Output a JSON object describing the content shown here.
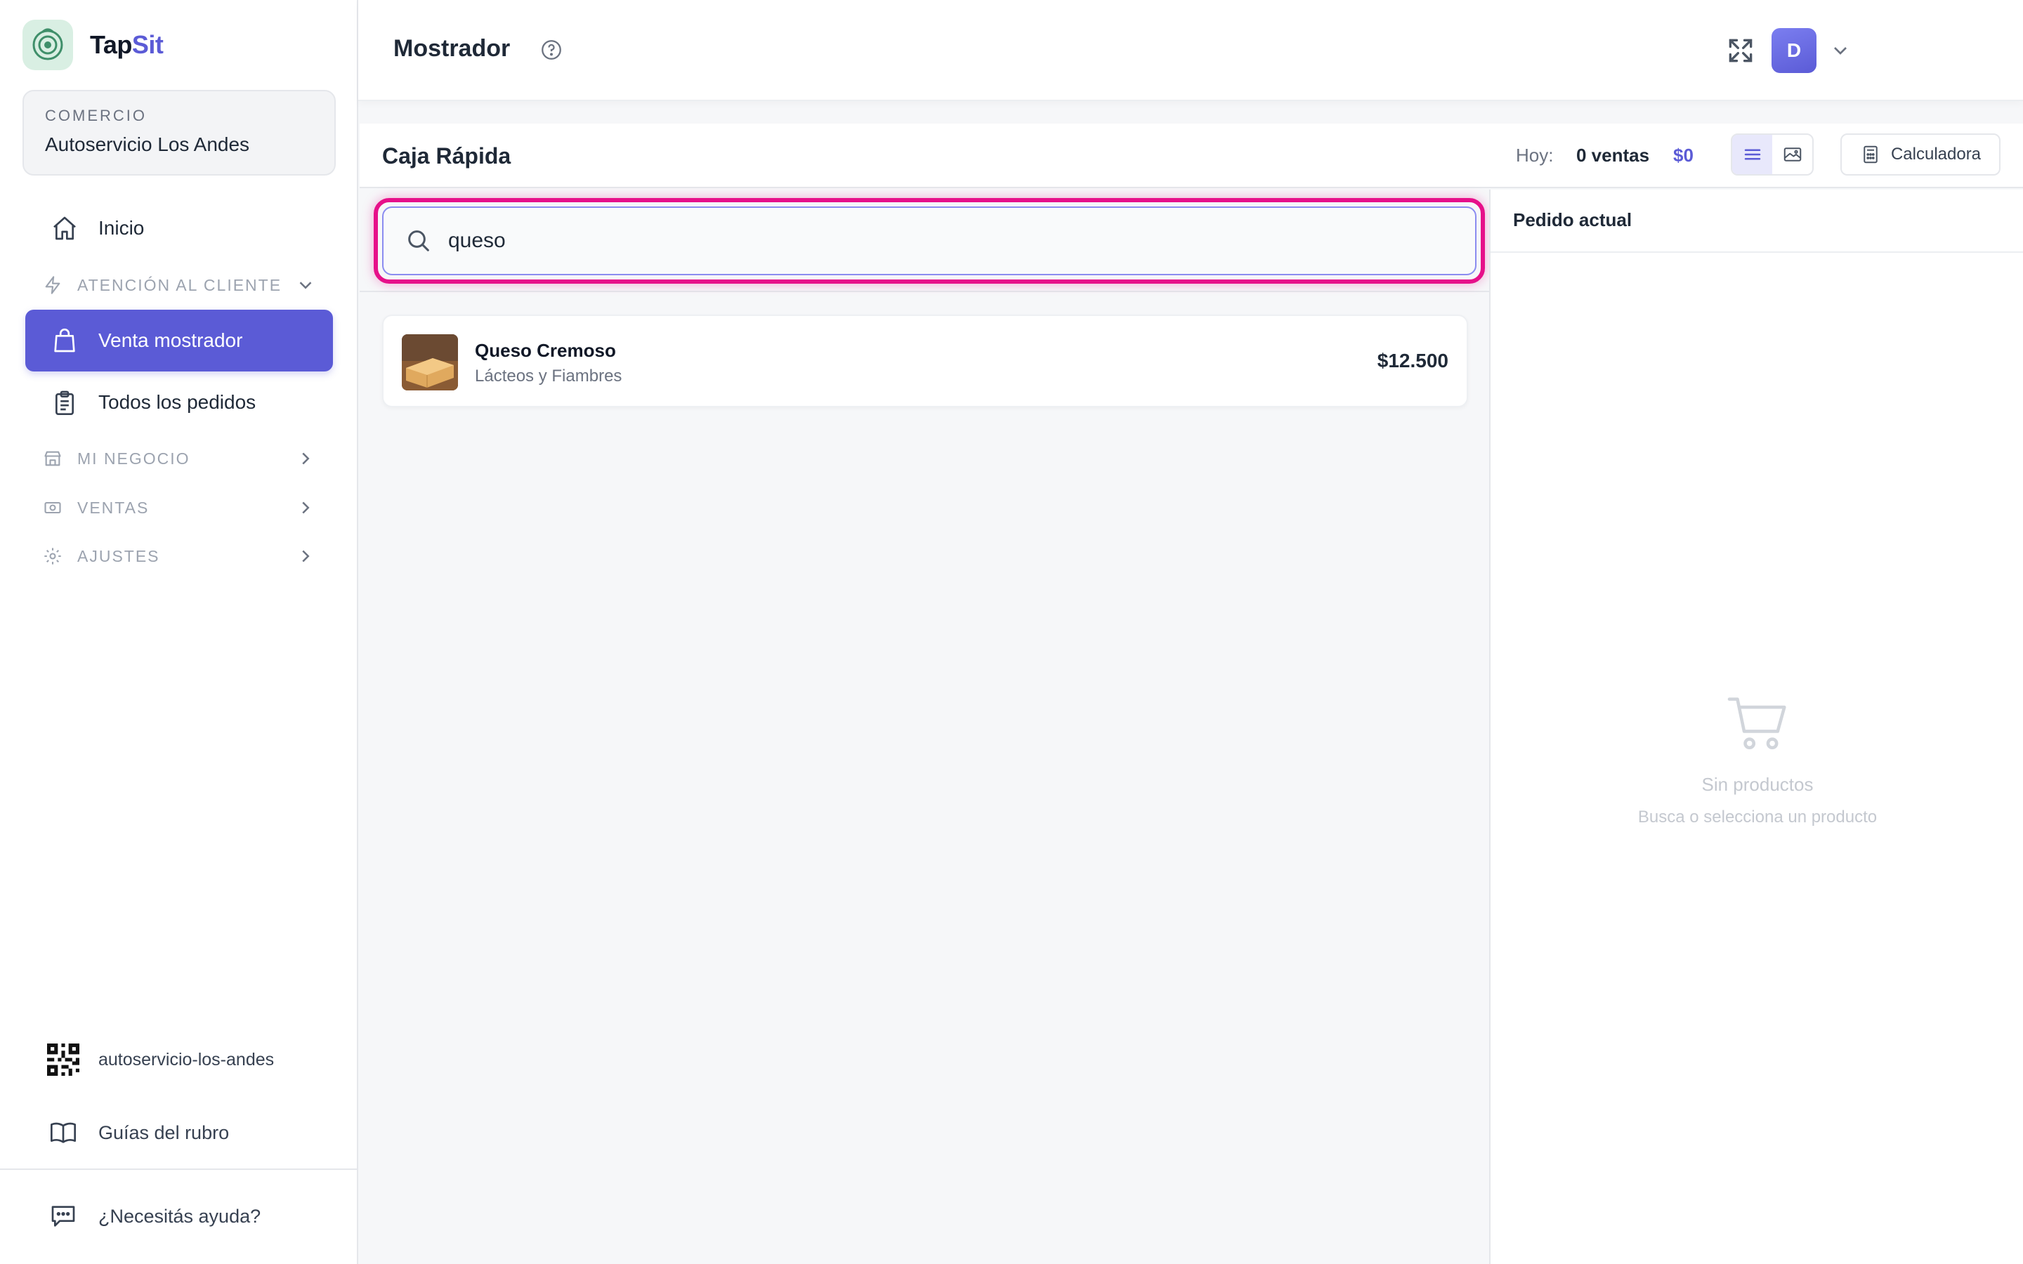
{
  "brand": {
    "name_part1": "Tap",
    "name_part2": "Sit"
  },
  "commerce": {
    "label": "COMERCIO",
    "name": "Autoservicio Los Andes"
  },
  "sidebar": {
    "inicio": "Inicio",
    "section_atencion": "ATENCIÓN AL CLIENTE",
    "venta_mostrador": "Venta mostrador",
    "todos_pedidos": "Todos los pedidos",
    "section_negocio": "MI NEGOCIO",
    "section_ventas": "VENTAS",
    "section_ajustes": "AJUSTES",
    "qr_slug": "autoservicio-los-andes",
    "guias": "Guías del rubro",
    "ayuda": "¿Necesitás ayuda?"
  },
  "topbar": {
    "title": "Mostrador",
    "avatar_initial": "D"
  },
  "caja": {
    "title": "Caja Rápida",
    "today_label": "Hoy:",
    "today_sales": "0 ventas",
    "today_amount": "$0",
    "calculator_label": "Calculadora"
  },
  "search": {
    "value": "queso"
  },
  "products": [
    {
      "name": "Queso Cremoso",
      "category": "Lácteos y Fiambres",
      "price": "$12.500"
    }
  ],
  "order": {
    "title": "Pedido actual",
    "empty_title": "Sin productos",
    "empty_subtitle": "Busca o selecciona un producto"
  },
  "colors": {
    "accent": "#5b5bd6",
    "highlight": "#e6108a",
    "logo_bg": "#d9efe3"
  }
}
